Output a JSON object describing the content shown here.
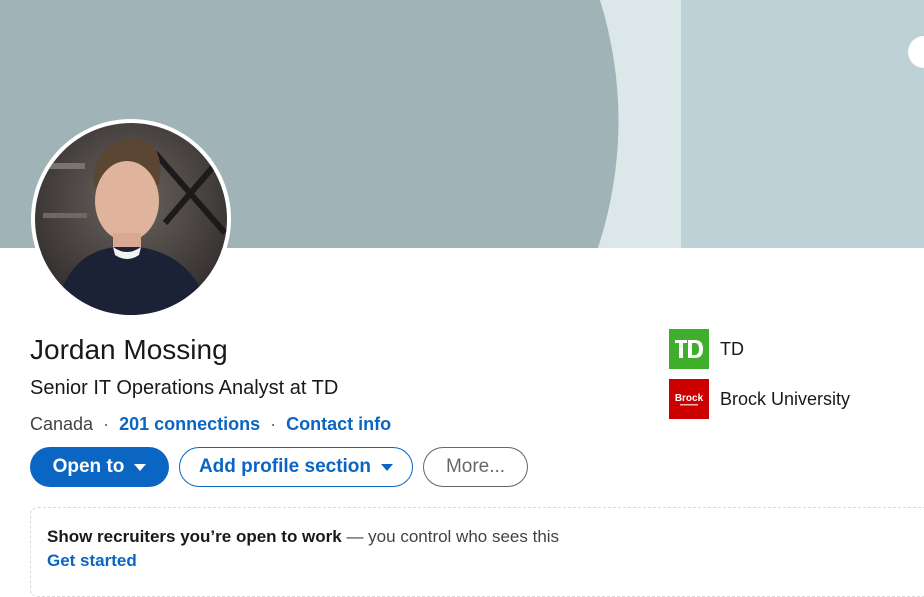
{
  "profile": {
    "name": "Jordan Mossing",
    "headline": "Senior IT Operations Analyst at TD",
    "location": "Canada",
    "separator": "·",
    "connections": "201 connections",
    "contact_info": "Contact info"
  },
  "actions": {
    "open_to": "Open to",
    "add_section": "Add profile section",
    "more": "More..."
  },
  "orgs": [
    {
      "name": "TD",
      "logo_text": "TD",
      "logo_color": "#3fae2a",
      "icon": "td-logo-icon"
    },
    {
      "name": "Brock University",
      "logo_text": "Brock",
      "logo_color": "#cc0000",
      "icon": "brock-logo-icon"
    }
  ],
  "open_to_work": {
    "bold": "Show recruiters you’re open to work",
    "rest": " — you control who sees this",
    "cta": "Get started"
  },
  "colors": {
    "accent": "#0a66c2",
    "banner_dark": "#a0b4b7",
    "banner_light": "#dce7e9",
    "banner_mid": "#bdd2d6"
  }
}
